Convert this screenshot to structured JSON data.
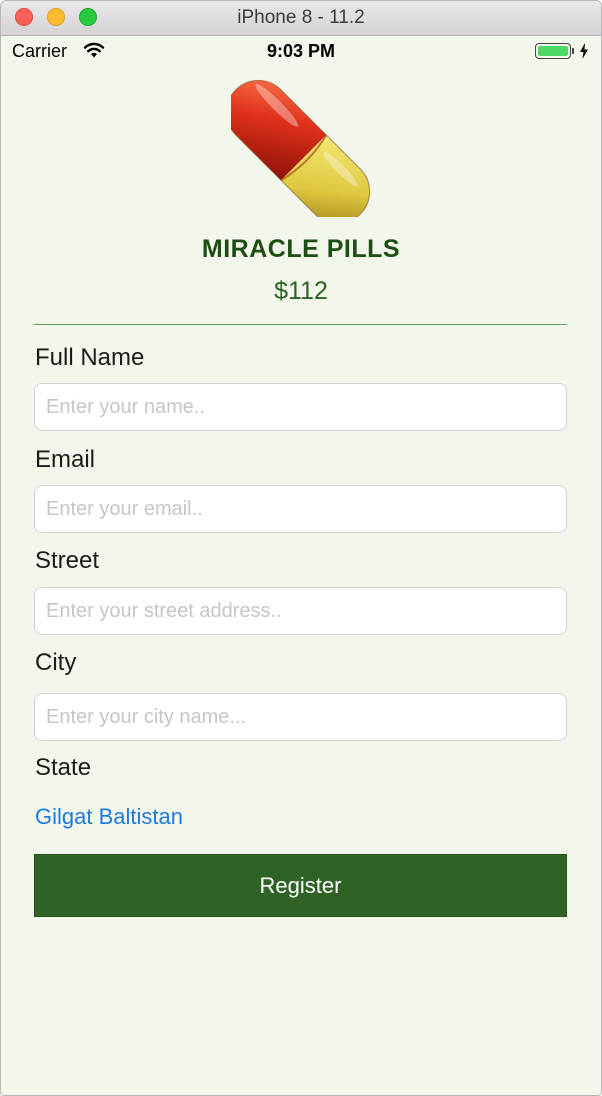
{
  "window": {
    "title": "iPhone 8 - 11.2"
  },
  "status_bar": {
    "carrier": "Carrier",
    "time": "9:03 PM",
    "icons": [
      "wifi-icon",
      "battery-icon",
      "charging-bolt-icon"
    ]
  },
  "product": {
    "image_icon": "pill-capsule-image",
    "name": "MIRACLE PILLS",
    "price": "$112"
  },
  "form": {
    "full_name": {
      "label": "Full Name",
      "placeholder": "Enter your name..",
      "value": ""
    },
    "email": {
      "label": "Email",
      "placeholder": "Enter your email..",
      "value": ""
    },
    "street": {
      "label": "Street",
      "placeholder": "Enter your street address..",
      "value": ""
    },
    "city": {
      "label": "City",
      "placeholder": "Enter your city name...",
      "value": ""
    },
    "state": {
      "label": "State",
      "value": "Gilgat Baltistan"
    },
    "register_label": "Register"
  },
  "colors": {
    "background": "#f3f6ea",
    "title_green": "#1d4f14",
    "button_green": "#2f6225",
    "link_blue": "#1e7ae0"
  }
}
